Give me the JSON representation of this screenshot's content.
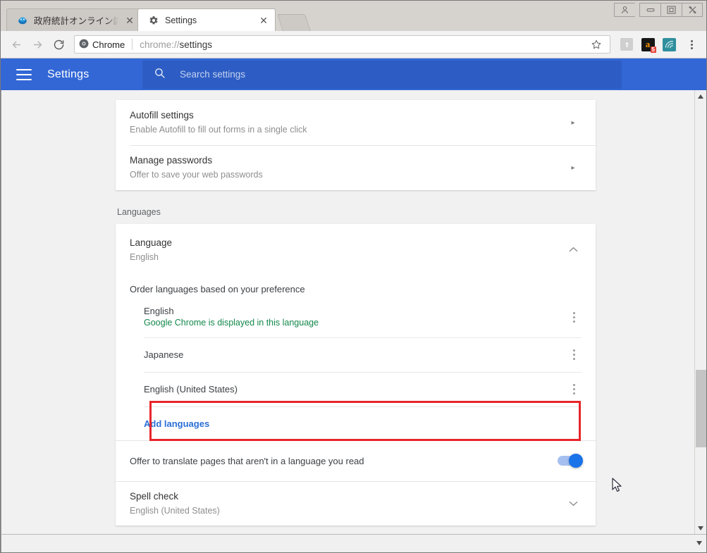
{
  "window": {
    "controls": [
      {
        "name": "user-profile",
        "glyph": "♟"
      },
      {
        "name": "minimize",
        "glyph": "–"
      },
      {
        "name": "maximize",
        "glyph": "▣"
      },
      {
        "name": "close",
        "glyph": "✕"
      }
    ]
  },
  "tabs": [
    {
      "title": "政府統計オンライン調査",
      "favicon": "site-favicon",
      "active": false,
      "close": "✕"
    },
    {
      "title": "Settings",
      "favicon": "gear-icon",
      "active": true,
      "close": "✕"
    }
  ],
  "toolbar": {
    "back": "←",
    "forward": "→",
    "reload": "⟳",
    "security_label": "Chrome",
    "url_scheme": "chrome://",
    "url_path": "settings",
    "url_full": "chrome://settings",
    "bookmark_icon": "star-icon",
    "extensions": [
      {
        "name": "extension-grey-icon",
        "label": ""
      },
      {
        "name": "amazon-extension-icon",
        "label": "a",
        "badge": "5"
      },
      {
        "name": "swirl-extension-icon",
        "label": ""
      }
    ],
    "menu": "chrome-menu-icon"
  },
  "settings_header": {
    "menu_icon": "hamburger-icon",
    "title": "Settings",
    "search_icon": "search-icon",
    "search_placeholder": "Search settings",
    "accent_color": "#3367d6",
    "search_bg": "#2d5dc4"
  },
  "autofill_card": [
    {
      "title": "Autofill settings",
      "subtitle": "Enable Autofill to fill out forms in a single click",
      "action": "▸"
    },
    {
      "title": "Manage passwords",
      "subtitle": "Offer to save your web passwords",
      "action": "▸"
    }
  ],
  "languages_section": {
    "label": "Languages",
    "language_row": {
      "title": "Language",
      "subtitle": "English",
      "expander": "˄"
    },
    "order_label": "Order languages based on your preference",
    "items": [
      {
        "name": "English",
        "note": "Google Chrome is displayed in this language",
        "note_color": "#12874a",
        "highlighted": true,
        "menu": "kebab-menu-icon"
      },
      {
        "name": "Japanese",
        "note": "",
        "highlighted": false,
        "menu": "kebab-menu-icon"
      },
      {
        "name": "English (United States)",
        "note": "",
        "highlighted": false,
        "menu": "kebab-menu-icon"
      }
    ],
    "add_languages": "Add languages",
    "translate_toggle": {
      "label": "Offer to translate pages that aren't in a language you read",
      "state": "on",
      "on_color": "#1a73e8"
    },
    "spell_check": {
      "title": "Spell check",
      "subtitle": "English (United States)",
      "expander": "˅"
    }
  },
  "highlight": {
    "color": "#e8252a"
  },
  "scrollbar": {
    "up": "▲",
    "down": "▼"
  },
  "bottom_frame": {
    "resize": "▼"
  }
}
